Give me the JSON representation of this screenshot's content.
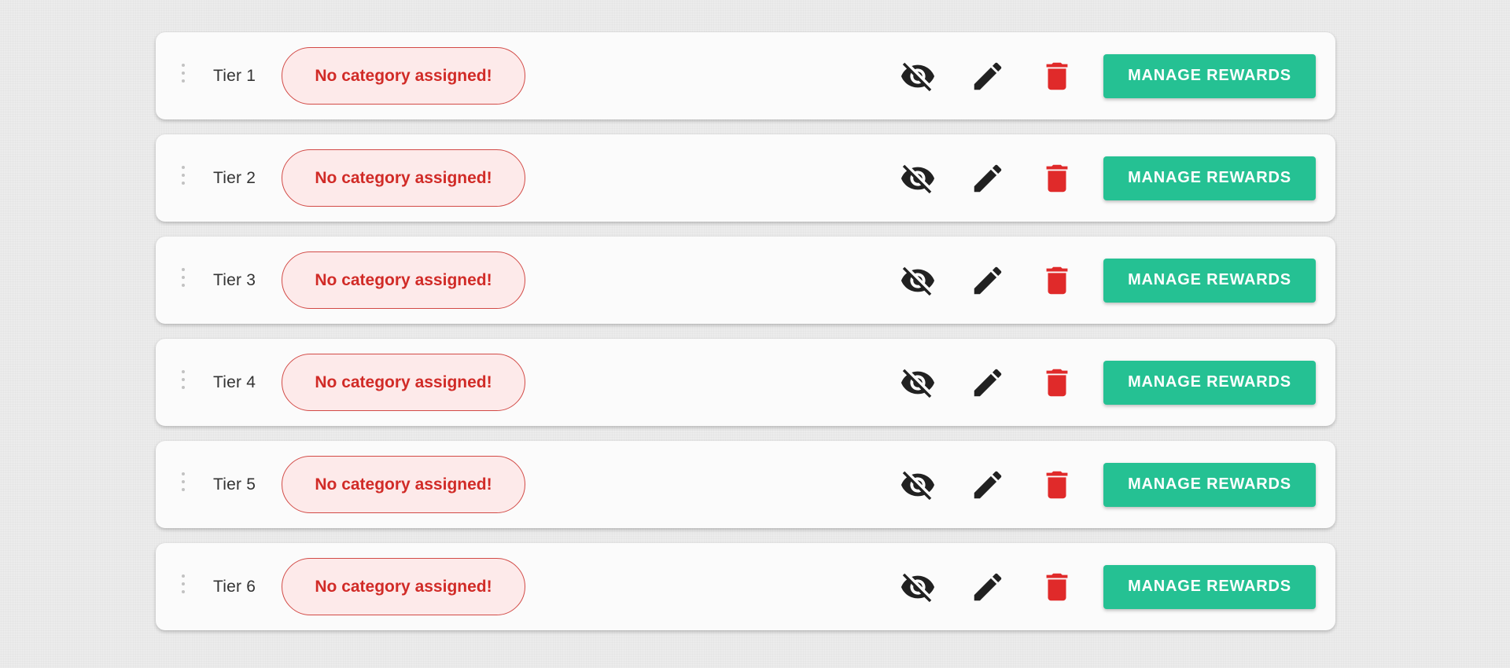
{
  "colors": {
    "page_background": "#ececec",
    "row_background": "#fbfbfb",
    "badge_text": "#d12b27",
    "badge_border": "#d24a46",
    "badge_fill": "#fdeaea",
    "delete_icon": "#e02a2a",
    "icon_dark": "#212121",
    "button_accent": "#25c193"
  },
  "icons": {
    "drag": "vertical-dots-drag-handle-icon",
    "hide": "eye-off-icon",
    "edit": "pencil-icon",
    "delete": "trash-icon"
  },
  "tiers": [
    {
      "label": "Tier 1",
      "category_status": "No category assigned!",
      "button_label": "MANAGE REWARDS"
    },
    {
      "label": "Tier 2",
      "category_status": "No category assigned!",
      "button_label": "MANAGE REWARDS"
    },
    {
      "label": "Tier 3",
      "category_status": "No category assigned!",
      "button_label": "MANAGE REWARDS"
    },
    {
      "label": "Tier 4",
      "category_status": "No category assigned!",
      "button_label": "MANAGE REWARDS"
    },
    {
      "label": "Tier 5",
      "category_status": "No category assigned!",
      "button_label": "MANAGE REWARDS"
    },
    {
      "label": "Tier 6",
      "category_status": "No category assigned!",
      "button_label": "MANAGE REWARDS"
    }
  ]
}
